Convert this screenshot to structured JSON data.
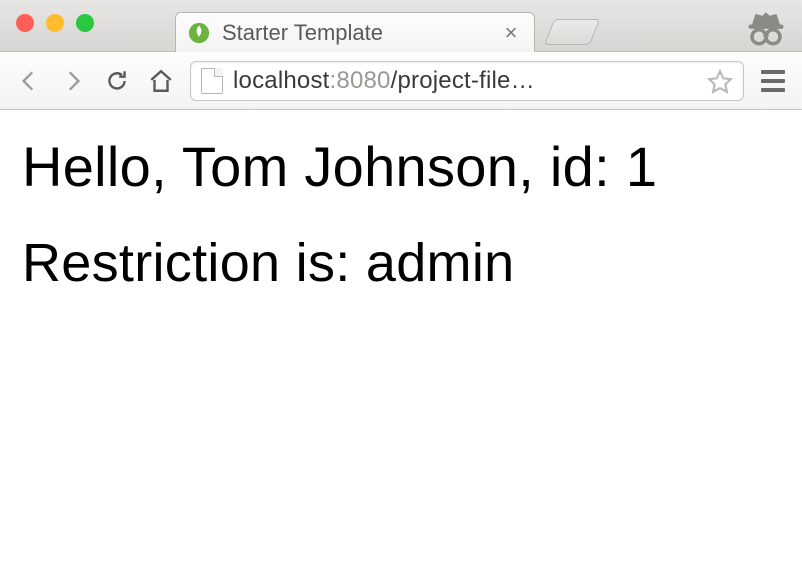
{
  "window": {
    "tab": {
      "title": "Starter Template"
    },
    "url": {
      "host": "localhost",
      "port": ":8080",
      "path": "/project-file…"
    }
  },
  "content": {
    "heading": "Hello, Tom Johnson, id: 1",
    "subheading": "Restriction is: admin"
  }
}
